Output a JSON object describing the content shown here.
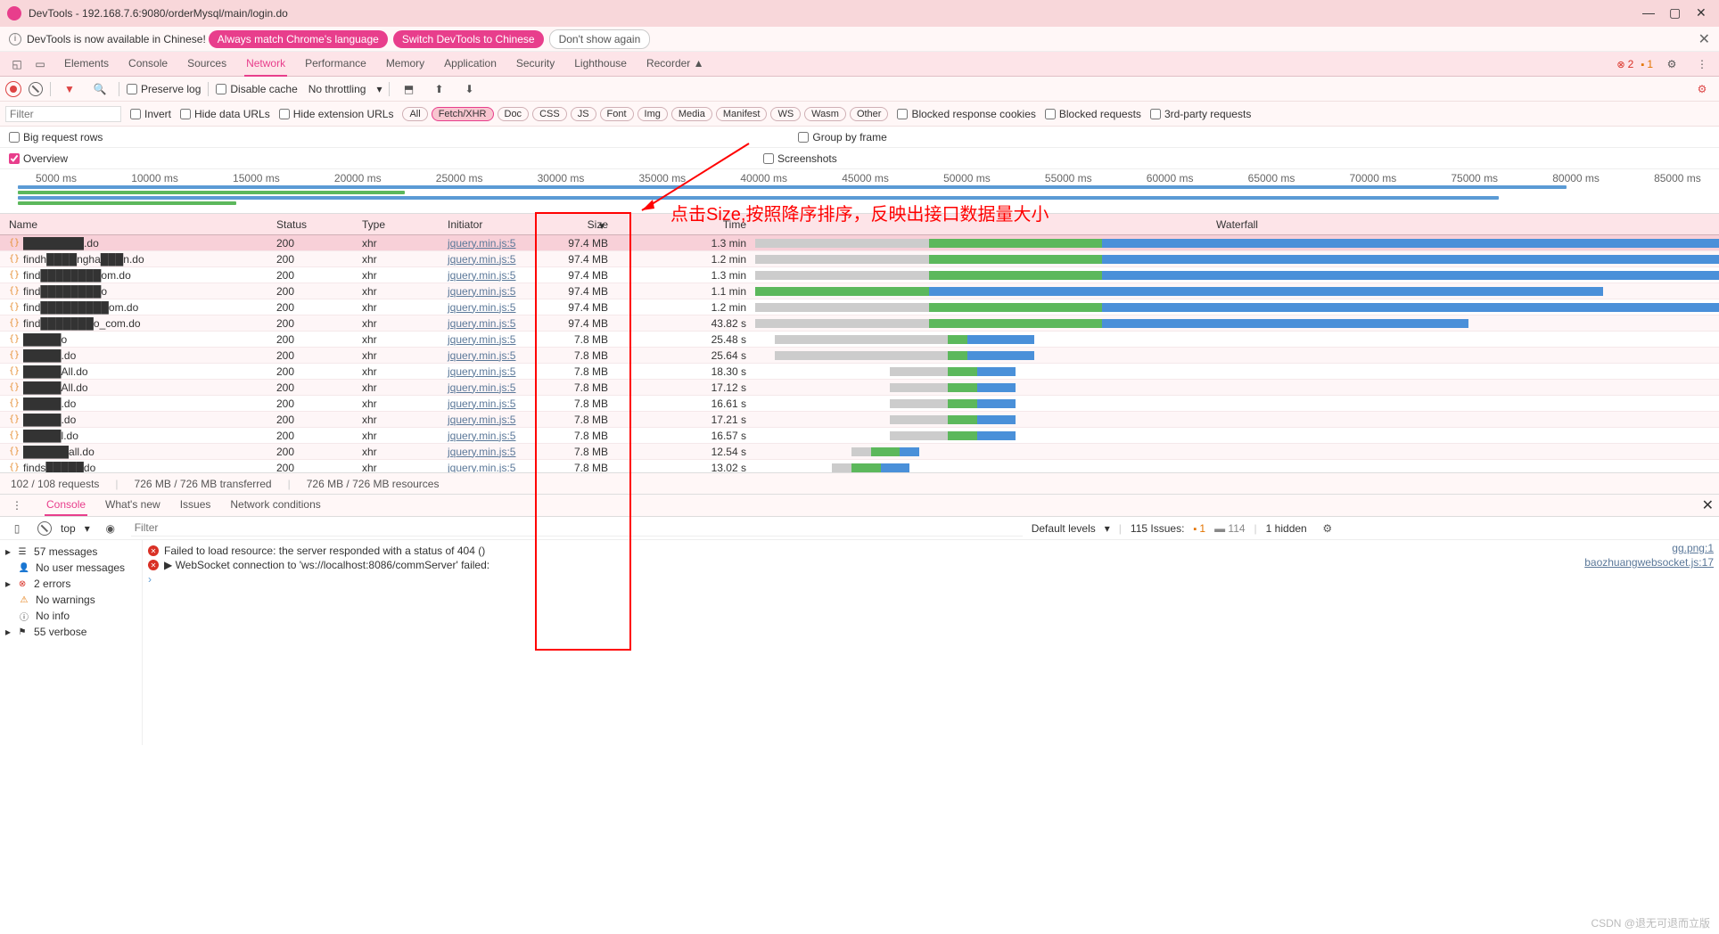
{
  "window": {
    "title": "DevTools - 192.168.7.6:9080/orderMysql/main/login.do",
    "min": "—",
    "max": "▢",
    "close": "✕"
  },
  "infobar": {
    "text": "DevTools is now available in Chinese!",
    "btn1": "Always match Chrome's language",
    "btn2": "Switch DevTools to Chinese",
    "btn3": "Don't show again"
  },
  "tabs": {
    "items": [
      "Elements",
      "Console",
      "Sources",
      "Network",
      "Performance",
      "Memory",
      "Application",
      "Security",
      "Lighthouse",
      "Recorder ▲"
    ],
    "active": 3,
    "errors": "2",
    "warnings": "1"
  },
  "toolbar1": {
    "preserve": "Preserve log",
    "disable": "Disable cache",
    "throttling": "No throttling"
  },
  "toolbar2": {
    "filter_ph": "Filter",
    "invert": "Invert",
    "hide_data": "Hide data URLs",
    "hide_ext": "Hide extension URLs",
    "chips": [
      "All",
      "Fetch/XHR",
      "Doc",
      "CSS",
      "JS",
      "Font",
      "Img",
      "Media",
      "Manifest",
      "WS",
      "Wasm",
      "Other"
    ],
    "chip_sel": 1,
    "blocked_cookies": "Blocked response cookies",
    "blocked_req": "Blocked requests",
    "third_party": "3rd-party requests"
  },
  "toolbar3": {
    "big_rows": "Big request rows",
    "group": "Group by frame",
    "overview": "Overview",
    "screenshots": "Screenshots"
  },
  "timeline_labels": [
    "5000 ms",
    "10000 ms",
    "15000 ms",
    "20000 ms",
    "25000 ms",
    "30000 ms",
    "35000 ms",
    "40000 ms",
    "45000 ms",
    "50000 ms",
    "55000 ms",
    "60000 ms",
    "65000 ms",
    "70000 ms",
    "75000 ms",
    "80000 ms",
    "85000 ms"
  ],
  "grid": {
    "headers": {
      "name": "Name",
      "status": "Status",
      "type": "Type",
      "initiator": "Initiator",
      "size": "Size",
      "time": "Time",
      "waterfall": "Waterfall"
    },
    "rows": [
      {
        "name": "████████.do",
        "status": "200",
        "type": "xhr",
        "initiator": "jquery.min.js:5",
        "size": "97.4 MB",
        "time": "1.3 min",
        "wg": 0,
        "wgrey": 18,
        "wgreen": 18,
        "wblue": 80
      },
      {
        "name": "findh████ngha███n.do",
        "status": "200",
        "type": "xhr",
        "initiator": "jquery.min.js:5",
        "size": "97.4 MB",
        "time": "1.2 min",
        "wg": 0,
        "wgrey": 18,
        "wgreen": 18,
        "wblue": 75
      },
      {
        "name": "find████████om.do",
        "status": "200",
        "type": "xhr",
        "initiator": "jquery.min.js:5",
        "size": "97.4 MB",
        "time": "1.3 min",
        "wg": 0,
        "wgrey": 18,
        "wgreen": 18,
        "wblue": 78
      },
      {
        "name": "find████████o",
        "status": "200",
        "type": "xhr",
        "initiator": "jquery.min.js:5",
        "size": "97.4 MB",
        "time": "1.1 min",
        "wg": 0,
        "wgrey": 0,
        "wgreen": 18,
        "wblue": 70
      },
      {
        "name": "find█████████om.do",
        "status": "200",
        "type": "xhr",
        "initiator": "jquery.min.js:5",
        "size": "97.4 MB",
        "time": "1.2 min",
        "wg": 0,
        "wgrey": 18,
        "wgreen": 18,
        "wblue": 72
      },
      {
        "name": "find███████o_com.do",
        "status": "200",
        "type": "xhr",
        "initiator": "jquery.min.js:5",
        "size": "97.4 MB",
        "time": "43.82 s",
        "wg": 0,
        "wgrey": 18,
        "wgreen": 18,
        "wblue": 38
      },
      {
        "name": "█████o",
        "status": "200",
        "type": "xhr",
        "initiator": "jquery.min.js:5",
        "size": "7.8 MB",
        "time": "25.48 s",
        "wg": 2,
        "wgrey": 18,
        "wgreen": 2,
        "wblue": 7
      },
      {
        "name": "█████.do",
        "status": "200",
        "type": "xhr",
        "initiator": "jquery.min.js:5",
        "size": "7.8 MB",
        "time": "25.64 s",
        "wg": 2,
        "wgrey": 18,
        "wgreen": 2,
        "wblue": 7
      },
      {
        "name": "█████All.do",
        "status": "200",
        "type": "xhr",
        "initiator": "jquery.min.js:5",
        "size": "7.8 MB",
        "time": "18.30 s",
        "wg": 14,
        "wgrey": 6,
        "wgreen": 3,
        "wblue": 4
      },
      {
        "name": "█████All.do",
        "status": "200",
        "type": "xhr",
        "initiator": "jquery.min.js:5",
        "size": "7.8 MB",
        "time": "17.12 s",
        "wg": 14,
        "wgrey": 6,
        "wgreen": 3,
        "wblue": 4
      },
      {
        "name": "█████.do",
        "status": "200",
        "type": "xhr",
        "initiator": "jquery.min.js:5",
        "size": "7.8 MB",
        "time": "16.61 s",
        "wg": 14,
        "wgrey": 6,
        "wgreen": 3,
        "wblue": 4
      },
      {
        "name": "█████.do",
        "status": "200",
        "type": "xhr",
        "initiator": "jquery.min.js:5",
        "size": "7.8 MB",
        "time": "17.21 s",
        "wg": 14,
        "wgrey": 6,
        "wgreen": 3,
        "wblue": 4
      },
      {
        "name": "█████l.do",
        "status": "200",
        "type": "xhr",
        "initiator": "jquery.min.js:5",
        "size": "7.8 MB",
        "time": "16.57 s",
        "wg": 14,
        "wgrey": 6,
        "wgreen": 3,
        "wblue": 4
      },
      {
        "name": "██████all.do",
        "status": "200",
        "type": "xhr",
        "initiator": "jquery.min.js:5",
        "size": "7.8 MB",
        "time": "12.54 s",
        "wg": 10,
        "wgrey": 2,
        "wgreen": 3,
        "wblue": 2
      },
      {
        "name": "finds█████do",
        "status": "200",
        "type": "xhr",
        "initiator": "jquery.min.js:5",
        "size": "7.8 MB",
        "time": "13.02 s",
        "wg": 8,
        "wgrey": 2,
        "wgreen": 3,
        "wblue": 3
      }
    ]
  },
  "statusbar": {
    "requests": "102 / 108 requests",
    "transferred": "726 MB / 726 MB transferred",
    "resources": "726 MB / 726 MB resources"
  },
  "drawer": {
    "tabs": [
      "Console",
      "What's new",
      "Issues",
      "Network conditions"
    ],
    "active": 0
  },
  "console_toolbar": {
    "context": "top",
    "filter_ph": "Filter",
    "levels": "Default levels",
    "issues_label": "115 Issues:",
    "issues_err": "1",
    "issues_msg": "114",
    "hidden": "1 hidden"
  },
  "console_sidebar": {
    "messages": "57 messages",
    "user": "No user messages",
    "errors": "2 errors",
    "warnings": "No warnings",
    "info": "No info",
    "verbose": "55 verbose"
  },
  "console_lines": [
    {
      "type": "error",
      "text": "Failed to load resource: the server responded with a status of 404 ()",
      "src": "gg.png:1"
    },
    {
      "type": "error",
      "text": "▶ WebSocket connection to 'ws://localhost:8086/commServer' failed:",
      "src": "baozhuangwebsocket.js:17"
    }
  ],
  "annotation": "点击Size,按照降序排序，反映出接口数据量大小",
  "watermark": "CSDN @退无可退而立版"
}
